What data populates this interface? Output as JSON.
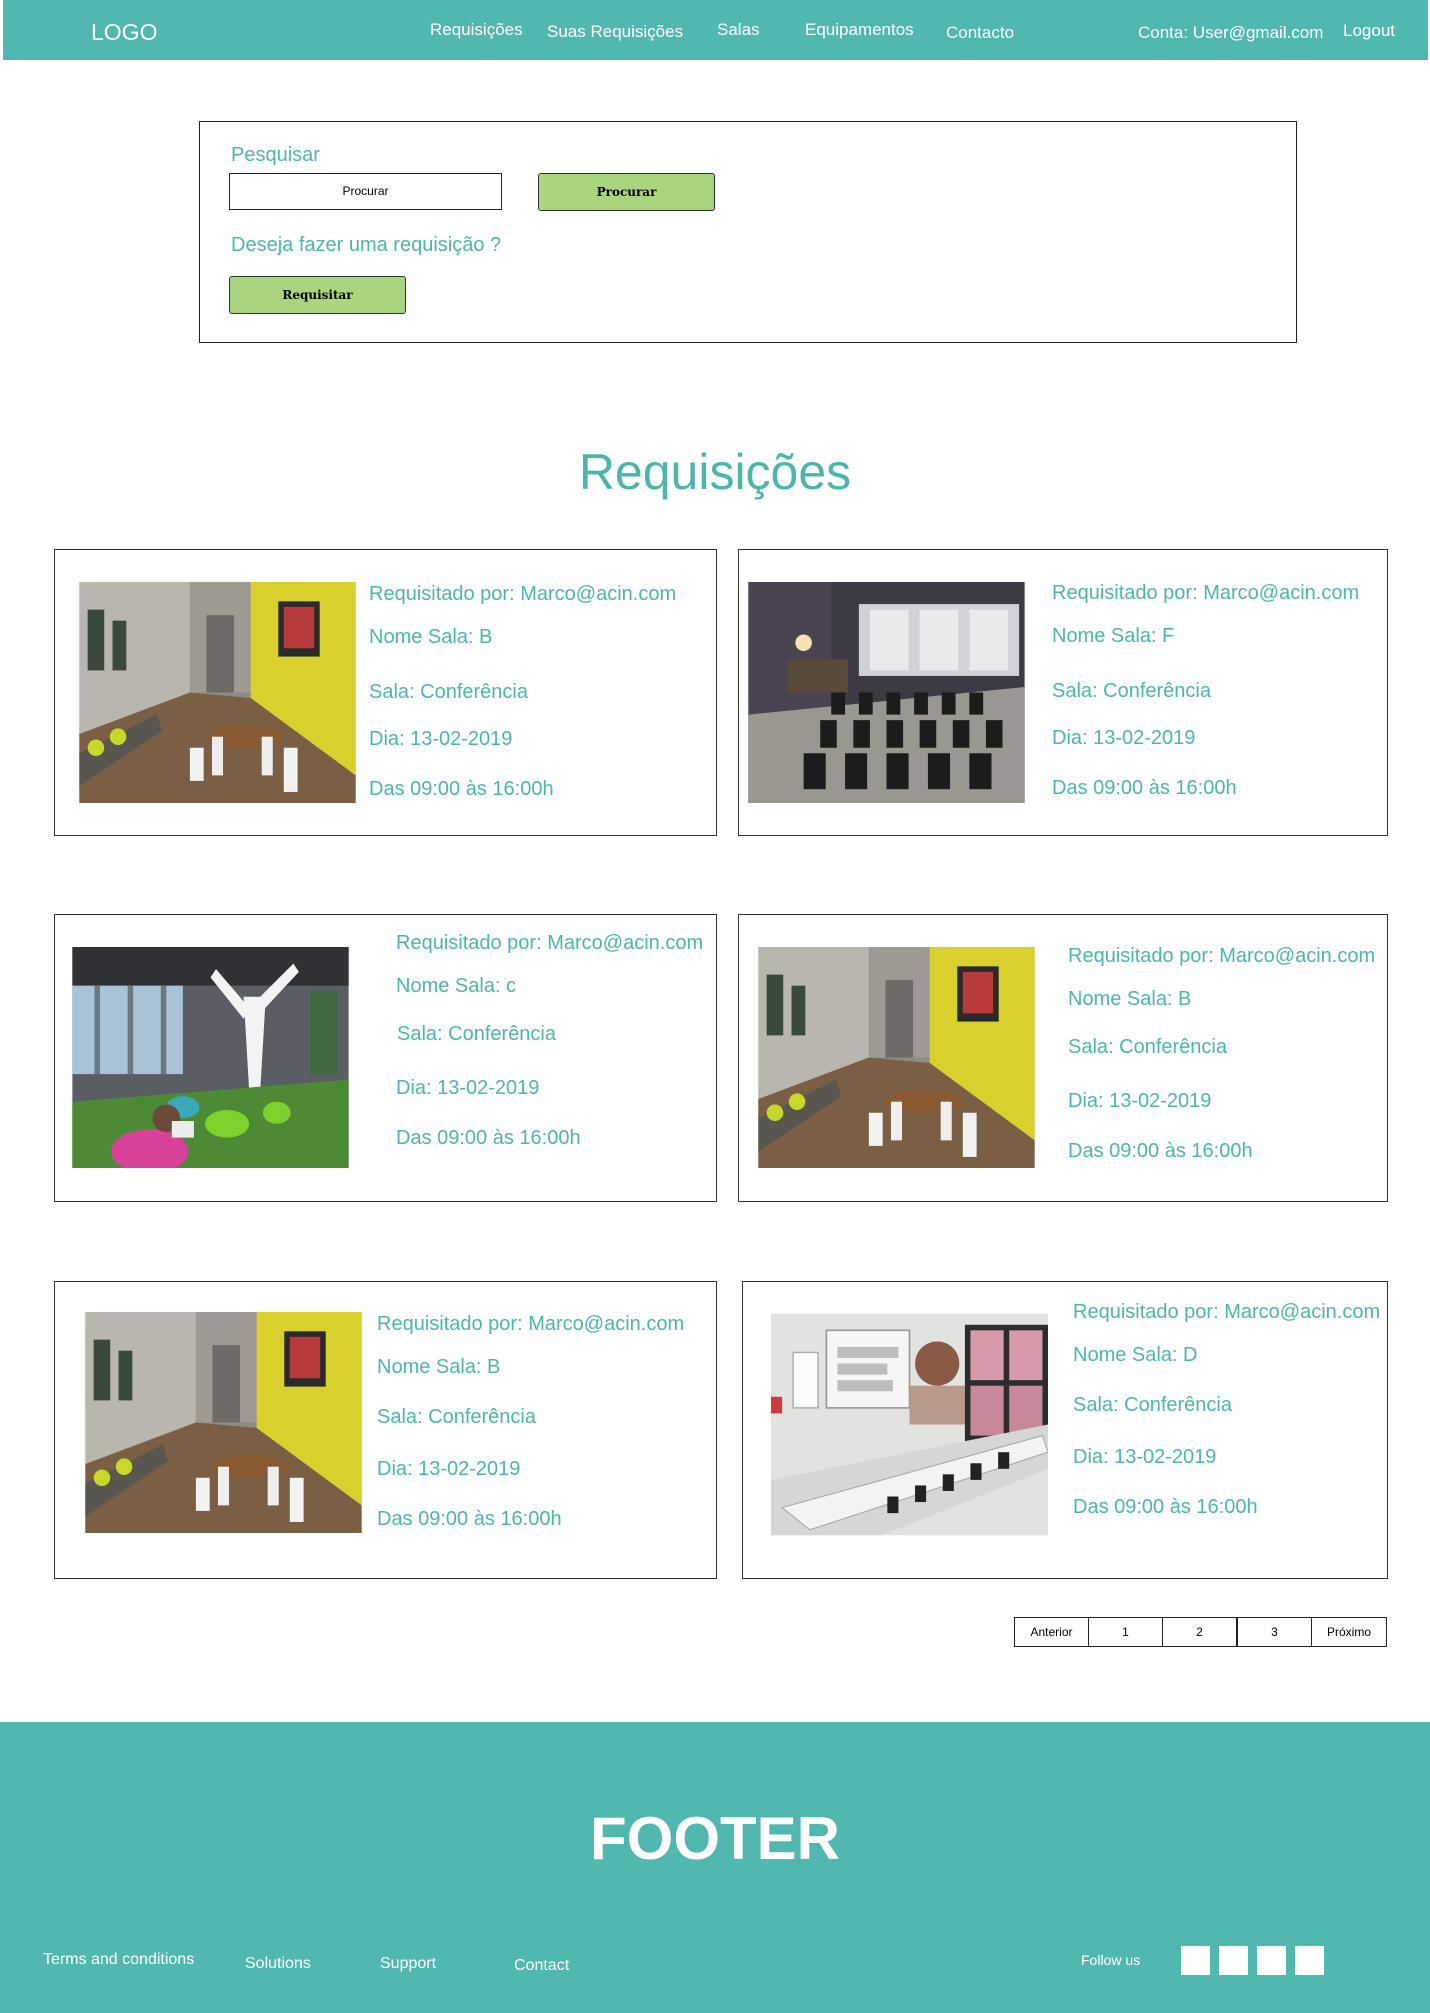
{
  "header": {
    "logo": "LOGO",
    "nav": [
      "Requisições",
      "Suas Requisições",
      "Salas",
      "Equipamentos",
      "Contacto"
    ],
    "account": "Conta: User@gmail.com",
    "logout": "Logout"
  },
  "search": {
    "heading": "Pesquisar",
    "input_value": "Procurar",
    "button": "Procurar",
    "request_prompt": "Deseja fazer uma requisição ?",
    "request_button": "Requisitar"
  },
  "page_title": "Requisições",
  "cards": [
    {
      "requested_by": "Requisitado por: Marco@acin.com",
      "room_name": "Nome Sala: B",
      "room_type": "Sala: Conferência",
      "day": "Dia: 13-02-2019",
      "hours": "Das 09:00 às 16:00h",
      "photo": "lounge-room"
    },
    {
      "requested_by": "Requisitado por: Marco@acin.com",
      "room_name": "Nome Sala: F",
      "room_type": "Sala: Conferência",
      "day": "Dia: 13-02-2019",
      "hours": "Das 09:00 às 16:00h",
      "photo": "auditorium-room"
    },
    {
      "requested_by": "Requisitado por: Marco@acin.com",
      "room_name": "Nome Sala: c",
      "room_type": "Sala: Conferência",
      "day": "Dia: 13-02-2019",
      "hours": "Das 09:00 às 16:00h",
      "photo": "open-space-room"
    },
    {
      "requested_by": "Requisitado por: Marco@acin.com",
      "room_name": "Nome Sala: B",
      "room_type": "Sala: Conferência",
      "day": "Dia: 13-02-2019",
      "hours": "Das 09:00 às 16:00h",
      "photo": "lounge-room"
    },
    {
      "requested_by": "Requisitado por: Marco@acin.com",
      "room_name": "Nome Sala: B",
      "room_type": "Sala: Conferência",
      "day": "Dia: 13-02-2019",
      "hours": "Das 09:00 às 16:00h",
      "photo": "lounge-room"
    },
    {
      "requested_by": "Requisitado por: Marco@acin.com",
      "room_name": "Nome Sala: D",
      "room_type": "Sala: Conferência",
      "day": "Dia: 13-02-2019",
      "hours": "Das 09:00 às 16:00h",
      "photo": "training-room"
    }
  ],
  "pagination": {
    "prev": "Anterior",
    "pages": [
      "1",
      "2",
      "3"
    ],
    "next": "Próximo"
  },
  "footer": {
    "title": "FOOTER",
    "links": [
      "Terms and conditions",
      "Solutions",
      "Support",
      "Contact"
    ],
    "follow": "Follow us"
  },
  "colors": {
    "primary": "#50b8af",
    "text_accent": "#4db6ac",
    "button": "#abd47e"
  }
}
